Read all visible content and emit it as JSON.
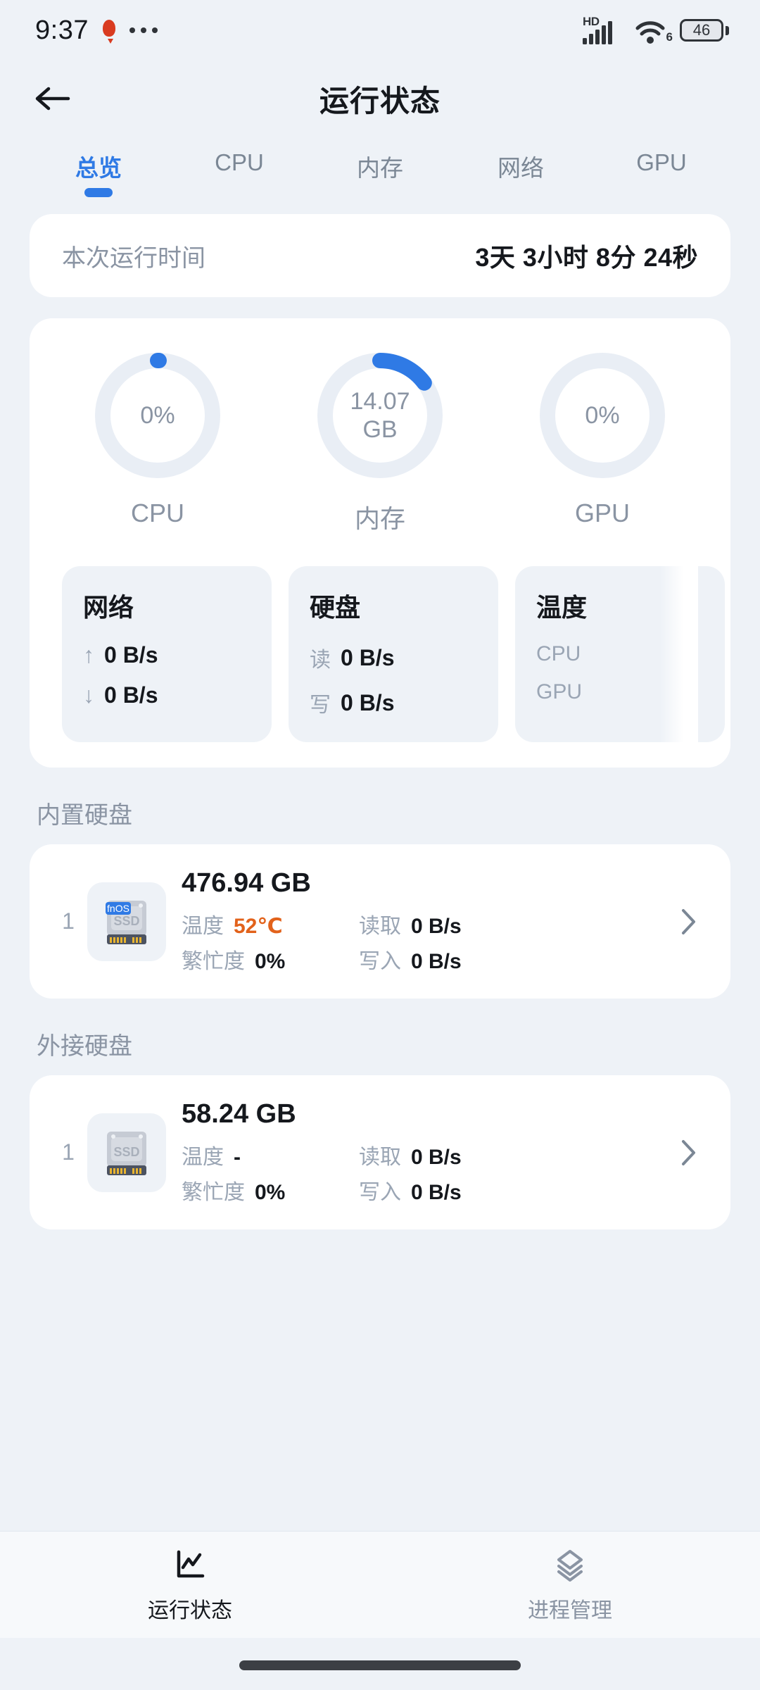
{
  "status_bar": {
    "time": "9:37",
    "balloon_icon": "balloon-icon",
    "more_icon": "ellipsis-icon",
    "network_label": "HD",
    "wifi_generation": "6",
    "battery_percent": "46"
  },
  "app_bar": {
    "back_icon": "back-arrow-icon",
    "title": "运行状态"
  },
  "tabs": [
    {
      "label": "总览",
      "active": true
    },
    {
      "label": "CPU",
      "active": false
    },
    {
      "label": "内存",
      "active": false
    },
    {
      "label": "网络",
      "active": false
    },
    {
      "label": "GPU",
      "active": false
    }
  ],
  "uptime": {
    "label": "本次运行时间",
    "value": "3天 3小时 8分 24秒"
  },
  "gauges": [
    {
      "name": "CPU",
      "value": "0%",
      "unit": "",
      "percent": 0.5
    },
    {
      "name": "内存",
      "value": "14.07",
      "unit": "GB",
      "percent": 15
    },
    {
      "name": "GPU",
      "value": "0%",
      "unit": "",
      "percent": 0
    }
  ],
  "mini_cards": [
    {
      "title": "网络",
      "rows": [
        {
          "icon": "arrow-up-icon",
          "key": "↑",
          "value": "0 B/s"
        },
        {
          "icon": "arrow-down-icon",
          "key": "↓",
          "value": "0 B/s"
        }
      ]
    },
    {
      "title": "硬盘",
      "rows": [
        {
          "icon": "",
          "key": "读",
          "value": "0 B/s"
        },
        {
          "icon": "",
          "key": "写",
          "value": "0 B/s"
        }
      ]
    },
    {
      "title": "温度",
      "rows": [
        {
          "icon": "",
          "key": "CPU",
          "value": ""
        },
        {
          "icon": "",
          "key": "GPU",
          "value": ""
        }
      ]
    }
  ],
  "internal_disks": {
    "section_label": "内置硬盘",
    "items": [
      {
        "index": "1",
        "icon": "ssd-fnos-icon",
        "badge": "fnOS",
        "icon_text": "SSD",
        "capacity": "476.94 GB",
        "temp_key": "温度",
        "temp_value": "52℃",
        "temp_hot": true,
        "busy_key": "繁忙度",
        "busy_value": "0%",
        "read_key": "读取",
        "read_value": "0 B/s",
        "write_key": "写入",
        "write_value": "0 B/s",
        "chevron": "chevron-right-icon"
      }
    ]
  },
  "external_disks": {
    "section_label": "外接硬盘",
    "items": [
      {
        "index": "1",
        "icon": "ssd-icon",
        "badge": "",
        "icon_text": "SSD",
        "capacity": "58.24 GB",
        "temp_key": "温度",
        "temp_value": "-",
        "temp_hot": false,
        "busy_key": "繁忙度",
        "busy_value": "0%",
        "read_key": "读取",
        "read_value": "0 B/s",
        "write_key": "写入",
        "write_value": "0 B/s",
        "chevron": "chevron-right-icon"
      }
    ]
  },
  "bottom_nav": [
    {
      "label": "运行状态",
      "icon": "chart-line-icon",
      "active": true
    },
    {
      "label": "进程管理",
      "icon": "layers-icon",
      "active": false
    }
  ],
  "colors": {
    "accent": "#2f7ae5",
    "background": "#eef2f7",
    "card": "#ffffff",
    "text_primary": "#15181d",
    "text_muted": "#8a94a3",
    "temp_hot": "#e2621b"
  }
}
